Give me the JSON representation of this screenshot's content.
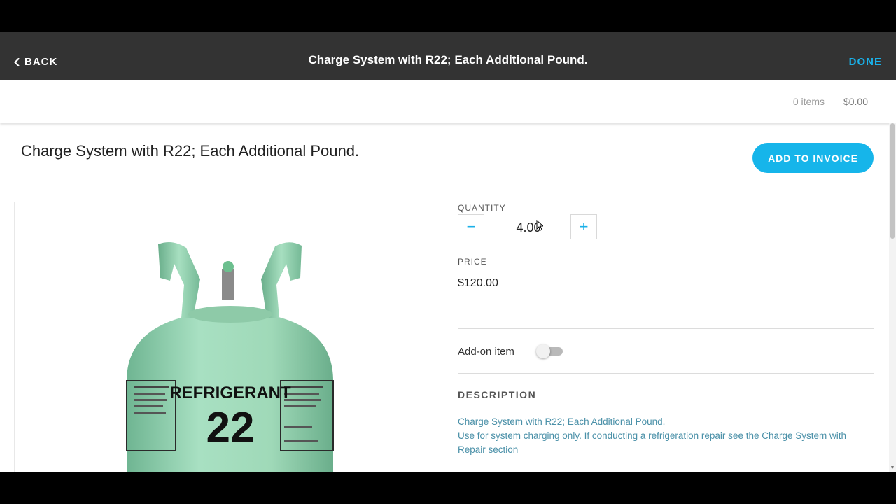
{
  "navbar": {
    "back_label": "BACK",
    "title": "Charge System with R22; Each Additional Pound.",
    "done_label": "DONE"
  },
  "summary": {
    "items_count": "0 items",
    "total": "$0.00"
  },
  "item": {
    "title": "Charge System with R22; Each Additional Pound.",
    "add_button_label": "ADD TO INVOICE",
    "image": {
      "cylinder_label": "REFRIGERANT",
      "cylinder_number": "22"
    },
    "quantity_label": "QUANTITY",
    "quantity_value": "4.00",
    "price_label": "PRICE",
    "price_value": "$120.00",
    "addon_label": "Add-on item",
    "addon_enabled": false,
    "description_label": "DESCRIPTION",
    "description_line1": "Charge System with R22; Each Additional Pound.",
    "description_line2": "Use for system charging only. If conducting a refrigeration repair see the Charge System with Repair section"
  },
  "colors": {
    "accent": "#1ab0e8",
    "navbar": "#333333",
    "button": "#16b5ea",
    "cylinder": "#9fd9b8",
    "description_text": "#4a90a8"
  },
  "icons": {
    "back": "chevron-left-icon",
    "minus": "minus-icon",
    "plus": "plus-icon"
  }
}
